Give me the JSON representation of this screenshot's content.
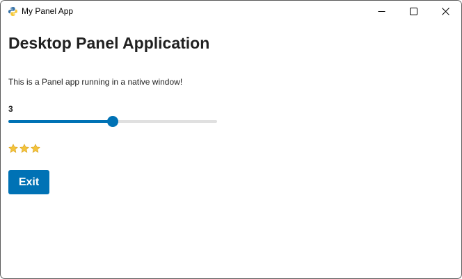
{
  "window": {
    "title": "My Panel App",
    "app_icon": "python-icon",
    "controls": {
      "minimize_icon": "minimize-icon",
      "maximize_icon": "maximize-icon",
      "close_icon": "close-icon"
    }
  },
  "main": {
    "heading": "Desktop Panel Application",
    "description": "This is a Panel app running in a native window!",
    "slider": {
      "value": 3,
      "value_label": "3",
      "fraction": 0.5
    },
    "stars": {
      "count": 3,
      "icon": "star-icon",
      "color": "#f3c33c"
    },
    "exit_button": {
      "label": "Exit"
    }
  },
  "colors": {
    "accent": "#0072b5",
    "track": "#e0e0e0",
    "text": "#212121"
  }
}
